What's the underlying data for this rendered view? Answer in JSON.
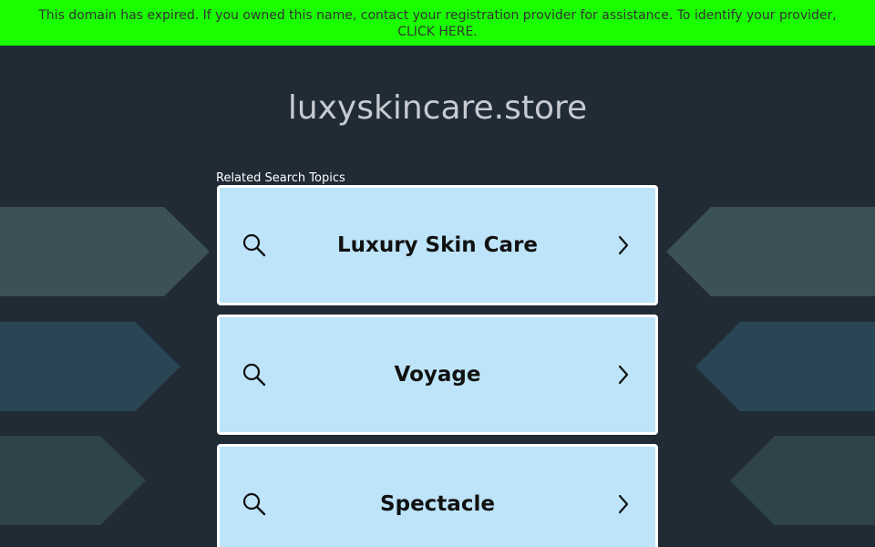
{
  "banner": {
    "text": "This domain has expired. If you owned this name, contact your registration provider for assistance. To identify your provider, ",
    "link_label": "CLICK HERE."
  },
  "domain": "luxyskincare.store",
  "related": {
    "heading": "Related Search Topics",
    "topics": [
      {
        "label": "Luxury Skin Care"
      },
      {
        "label": "Voyage"
      },
      {
        "label": "Spectacle"
      }
    ]
  },
  "colors": {
    "banner_bg": "#1aff00",
    "page_bg": "#202b36",
    "card_bg": "#bde4f9"
  },
  "icons": [
    "search-icon",
    "chevron-right-icon"
  ]
}
